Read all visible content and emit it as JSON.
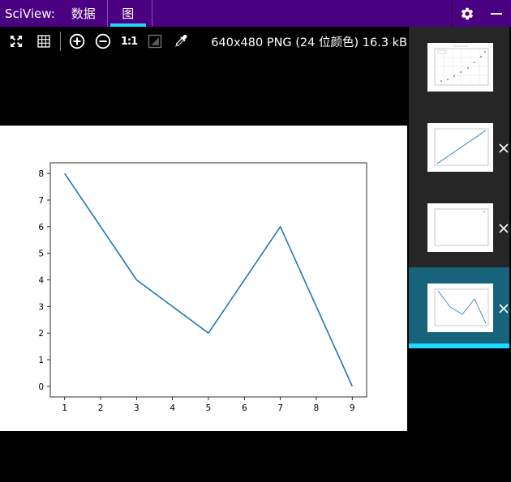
{
  "app": {
    "title": "SciView:",
    "tabs": [
      {
        "label": "数据",
        "active": false
      },
      {
        "label": "图",
        "active": true
      }
    ]
  },
  "toolbar": {
    "image_info": "640x480 PNG (24 位颜色) 16.3 kB",
    "actual_size_label": "1:1",
    "icons": [
      "fit-screen-icon",
      "grid-icon",
      "zoom-in-icon",
      "zoom-out-icon",
      "actual-size-icon",
      "background-icon",
      "eyedropper-icon"
    ]
  },
  "colors": {
    "topbar": "#4b0082",
    "accent": "#1ed9ff",
    "selected_thumb": "#17637b",
    "line": "#1f77b4"
  },
  "chart_data": {
    "type": "line",
    "title": "",
    "xlabel": "",
    "ylabel": "",
    "x": [
      1,
      3,
      5,
      7,
      9
    ],
    "series": [
      {
        "values": [
          8,
          4,
          2,
          6,
          0
        ]
      }
    ],
    "xticks": [
      1,
      2,
      3,
      4,
      5,
      6,
      7,
      8,
      9
    ],
    "yticks": [
      0,
      1,
      2,
      3,
      4,
      5,
      6,
      7,
      8
    ],
    "xlim": [
      0.6,
      9.4
    ],
    "ylim": [
      -0.4,
      8.4
    ],
    "grid": false
  },
  "thumbnails": [
    {
      "name": "scatter-plot-thumbnail",
      "selected": false
    },
    {
      "name": "linear-line-thumbnail",
      "selected": false
    },
    {
      "name": "empty-plot-thumbnail",
      "selected": false
    },
    {
      "name": "current-line-thumbnail",
      "selected": true
    }
  ]
}
